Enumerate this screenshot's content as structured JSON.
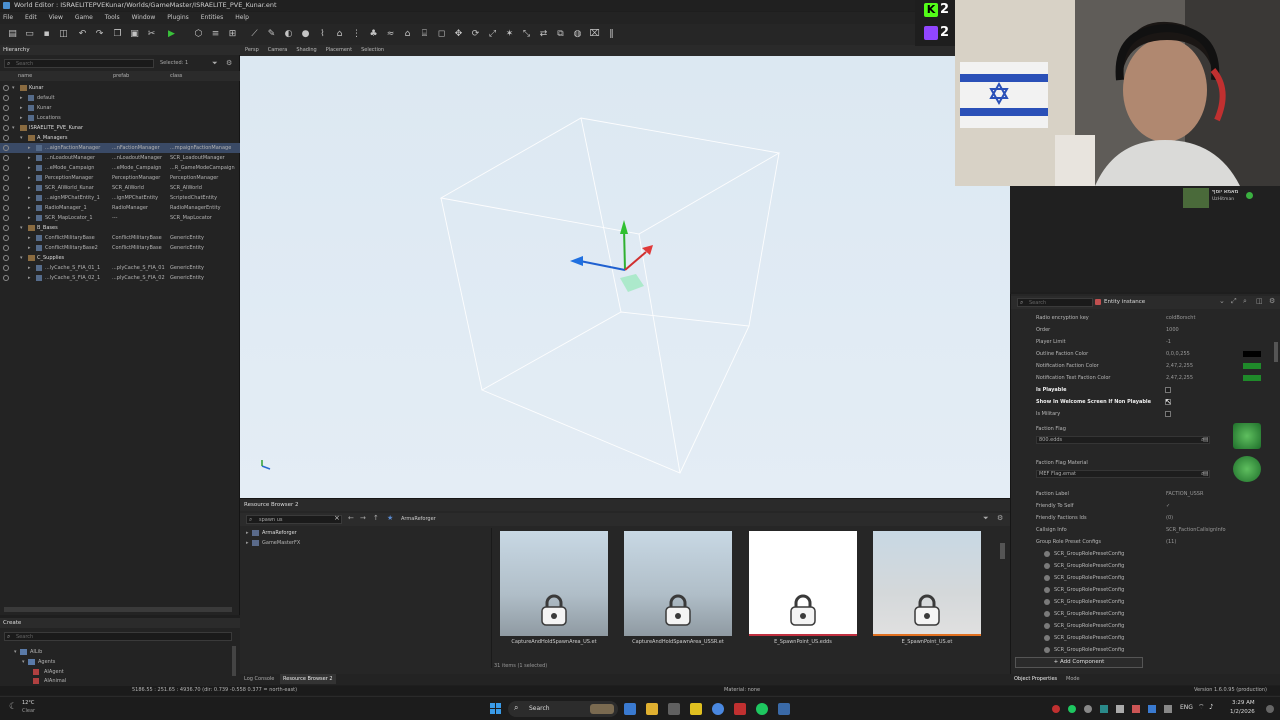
{
  "window": {
    "title": "World Editor : ISRAELITEPVEKunar/Worlds/GameMaster/ISRAELITE_PVE_Kunar.ent"
  },
  "menu": [
    "File",
    "Edit",
    "View",
    "Game",
    "Tools",
    "Window",
    "Plugins",
    "Entities",
    "Help"
  ],
  "subtoolbar": [
    "Persp",
    "Camera",
    "Shading",
    "Placement",
    "Selection"
  ],
  "hierarchy": {
    "title": "Hierarchy",
    "search_placeholder": "Search",
    "selected": "Selected: 1",
    "columns": [
      "name",
      "prefab",
      "class"
    ],
    "rows": [
      {
        "name": "Kunar",
        "prefab": "",
        "class": ""
      },
      {
        "name": "default",
        "prefab": "",
        "class": ""
      },
      {
        "name": "Kunar",
        "prefab": "",
        "class": ""
      },
      {
        "name": "Locations",
        "prefab": "",
        "class": ""
      },
      {
        "name": "ISRAELITE_PVE_Kunar",
        "prefab": "",
        "class": ""
      },
      {
        "name": "A_Managers",
        "prefab": "",
        "class": ""
      },
      {
        "name": "...aignFactionManager",
        "prefab": "...nFactionManager",
        "class": "...mpaignFactionManage"
      },
      {
        "name": "...nLoadoutManager",
        "prefab": "...nLoadoutManager",
        "class": "SCR_LoadoutManager"
      },
      {
        "name": "...eMode_Campaign",
        "prefab": "...eMode_Campaign",
        "class": "...R_GameModeCampaign"
      },
      {
        "name": "PerceptionManager",
        "prefab": "PerceptionManager",
        "class": "PerceptionManager"
      },
      {
        "name": "SCR_AIWorld_Kunar",
        "prefab": "SCR_AIWorld",
        "class": "SCR_AIWorld"
      },
      {
        "name": "...aignMPChatEntity_1",
        "prefab": "...ignMPChatEntity",
        "class": "ScriptedChatEntity"
      },
      {
        "name": "RadioManager_1",
        "prefab": "RadioManager",
        "class": "RadioManagerEntity"
      },
      {
        "name": "SCR_MapLocator_1",
        "prefab": "---",
        "class": "SCR_MapLocator"
      },
      {
        "name": "B_Bases",
        "prefab": "",
        "class": ""
      },
      {
        "name": "ConflictMilitaryBase",
        "prefab": "ConflictMilitaryBase",
        "class": "GenericEntity"
      },
      {
        "name": "ConflictMilitaryBase2",
        "prefab": "ConflictMilitaryBase",
        "class": "GenericEntity"
      },
      {
        "name": "C_Supplies",
        "prefab": "",
        "class": ""
      },
      {
        "name": "...lyCache_S_FIA_01_1",
        "prefab": "...plyCache_S_FIA_01",
        "class": "GenericEntity"
      },
      {
        "name": "...lyCache_S_FIA_02_1",
        "prefab": "...plyCache_S_FIA_02",
        "class": "GenericEntity"
      }
    ]
  },
  "create": {
    "title": "Create",
    "search_placeholder": "Search",
    "tree": [
      "AILib",
      "Agents",
      "AIAgent",
      "AIAnimal"
    ]
  },
  "resource_browser": {
    "title": "Resource Browser 2",
    "search_value": "spawn us",
    "path": "ArmaReforger",
    "tree": [
      "ArmaReforger",
      "GameMasterFX"
    ],
    "items": [
      {
        "label": "CaptureAndHoldSpawnArea_US.et"
      },
      {
        "label": "CaptureAndHoldSpawnArea_USSR.et"
      },
      {
        "label": "E_SpawnPoint_US.edds"
      },
      {
        "label": "E_SpawnPoint_US.et"
      }
    ],
    "count": "31 items (1 selected)"
  },
  "bottom_tabs": [
    "Log Console",
    "Resource Browser 2"
  ],
  "statusbar": {
    "coords": "5186.55 : 251.65 : 4936.70 (dir: 0.739 -0.558 0.377 = north-east)",
    "material": "Material: none",
    "version": "Version 1.6.0.95 (production)"
  },
  "properties": {
    "title": "Entity instance",
    "search_placeholder": "Search",
    "rows": [
      {
        "label": "Radio encryption key",
        "value": "coldBorscht"
      },
      {
        "label": "Order",
        "value": "1000"
      },
      {
        "label": "Player Limit",
        "value": "-1"
      },
      {
        "label": "Outline Faction Color",
        "value": "0,0,0,255"
      },
      {
        "label": "Notification Faction Color",
        "value": "2,47,2,255"
      },
      {
        "label": "Notification Text Faction Color",
        "value": "2,47,2,255"
      },
      {
        "label": "Is Playable",
        "value": ""
      },
      {
        "label": "Show In Welcome Screen If Non Playable",
        "value": ""
      },
      {
        "label": "Is Military",
        "value": ""
      }
    ],
    "faction_flag": {
      "label": "Faction Flag",
      "value": "800.edds"
    },
    "faction_flag_material": {
      "label": "Faction Flag Material",
      "value": "MEF Flag.emat"
    },
    "rows2": [
      {
        "label": "Faction Label",
        "value": "FACTION_USSR"
      },
      {
        "label": "Friendly To Self",
        "value": "✓"
      },
      {
        "label": "Friendly Factions Ids",
        "value": "(0)"
      },
      {
        "label": "Callsign Info",
        "value": "SCR_FactionCallsignInfo"
      },
      {
        "label": "Group Role Preset Configs",
        "value": "(11)"
      }
    ],
    "configs": [
      "SCR_GroupRolePresetConfig",
      "SCR_GroupRolePresetConfig",
      "SCR_GroupRolePresetConfig",
      "SCR_GroupRolePresetConfig",
      "SCR_GroupRolePresetConfig",
      "SCR_GroupRolePresetConfig",
      "SCR_GroupRolePresetConfig",
      "SCR_GroupRolePresetConfig",
      "SCR_GroupRolePresetConfig"
    ],
    "add_component": "+ Add Component",
    "tabs": [
      "Object Properties",
      "Mode"
    ]
  },
  "stream": {
    "kick_count": "2",
    "twitch_count": "2",
    "user_name": "מאמא יוסף",
    "user_sub": "UzHitman"
  },
  "taskbar": {
    "weather_temp": "12°C",
    "weather_desc": "Clear",
    "search_label": "Search",
    "lang": "ENG",
    "time": "3:29 AM",
    "date": "1/2/2026"
  },
  "colors": {
    "accent": "#3b6ea8",
    "kick": "#53fc18",
    "twitch": "#9146ff",
    "editor_bg": "#262626"
  }
}
